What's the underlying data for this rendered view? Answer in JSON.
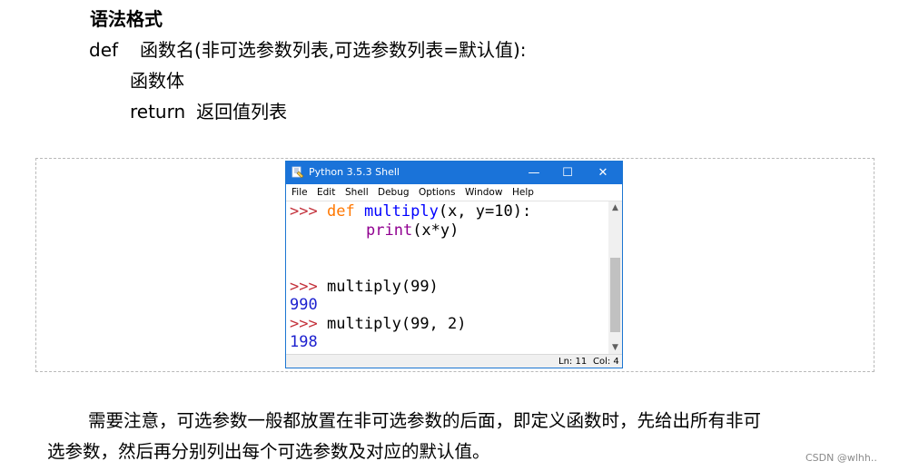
{
  "heading": "语法格式",
  "syntax": {
    "line1_keyword": "def",
    "line1_body": "函数名(非可选参数列表,可选参数列表=默认值):",
    "line2": "函数体",
    "line3_keyword": "return",
    "line3_body": "返回值列表"
  },
  "shell": {
    "title": "Python 3.5.3 Shell",
    "window_buttons": {
      "minimize": "—",
      "maximize": "☐",
      "close": "✕"
    },
    "menu": [
      "File",
      "Edit",
      "Shell",
      "Debug",
      "Options",
      "Window",
      "Help"
    ],
    "code": {
      "line1_prompt": ">>>",
      "line1_def": "def",
      "line1_name": "multiply",
      "line1_args": "(x, y=10):",
      "line2_builtin": "print",
      "line2_args": "(x*y)",
      "line3_prompt": ">>>",
      "line3_code": "multiply(99)",
      "line4_output": "990",
      "line5_prompt": ">>>",
      "line5_code": "multiply(99, 2)",
      "line6_output": "198"
    },
    "status": {
      "ln": "Ln: 11",
      "col": "Col: 4"
    },
    "colors": {
      "titlebar": "#1a73d9",
      "prompt": "#c3303a",
      "keyword": "#ff7700",
      "function_name": "#0000ff",
      "builtin": "#900090",
      "output": "#1d21cf"
    }
  },
  "paragraph": {
    "line1": "需要注意，可选参数一般都放置在非可选参数的后面，即定义函数时，先给出所有非可",
    "line2": "选参数，然后再分别列出每个可选参数及对应的默认值。"
  },
  "watermark": "CSDN @wlhh.."
}
